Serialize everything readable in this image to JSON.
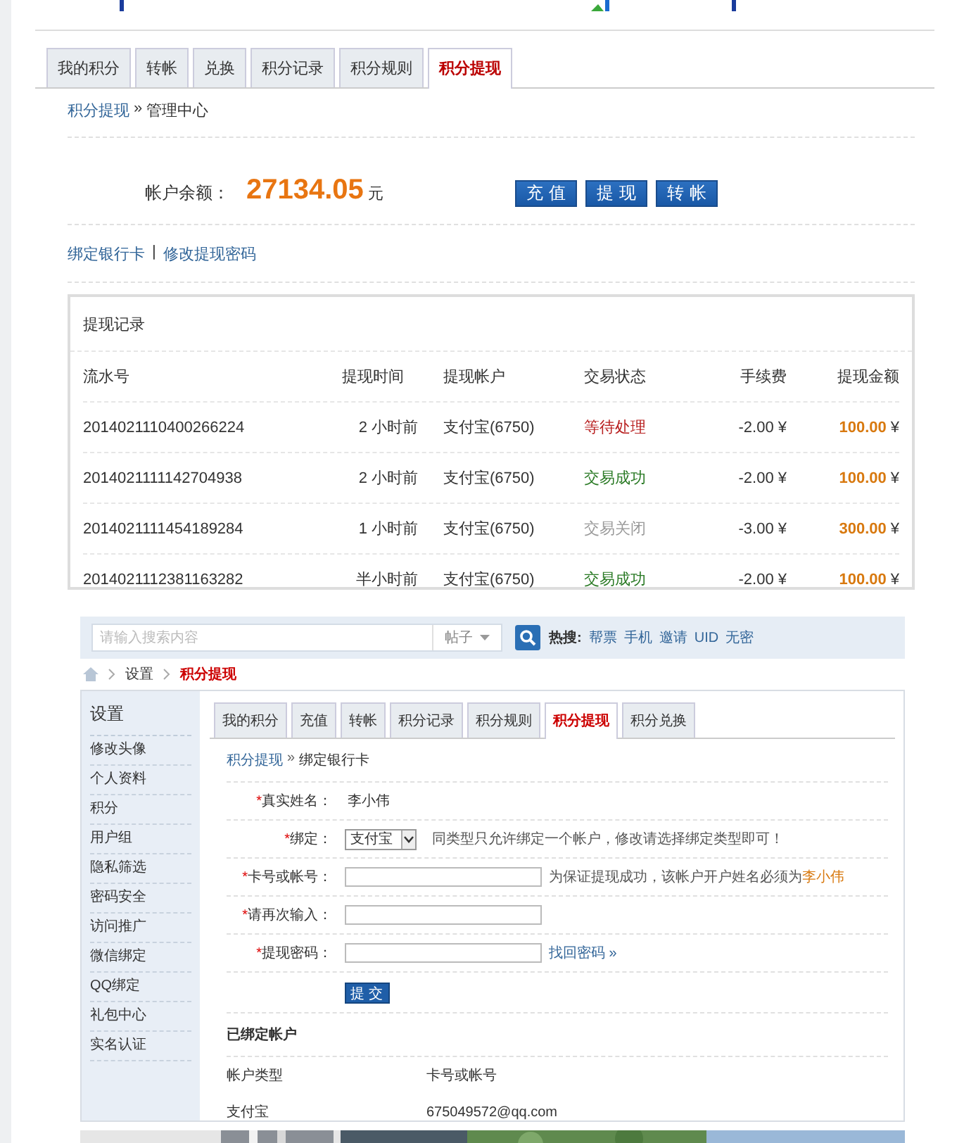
{
  "screen_1": {
    "tabs": [
      {
        "label": "我的积分",
        "selected": false
      },
      {
        "label": "转帐",
        "selected": false
      },
      {
        "label": "兑换",
        "selected": false
      },
      {
        "label": "积分记录",
        "selected": false
      },
      {
        "label": "积分规则",
        "selected": false
      },
      {
        "label": "积分提现",
        "selected": true
      }
    ],
    "breadcrumb": {
      "link": "积分提现",
      "separator": "»",
      "current": "管理中心"
    },
    "balance": {
      "label": "帐户余额：",
      "amount": "27134.05",
      "unit": "元"
    },
    "buttons": [
      "充值",
      "提现",
      "转帐"
    ],
    "links": [
      "绑定银行卡",
      "修改提现密码"
    ],
    "link_separator": "|",
    "records": {
      "title": "提现记录",
      "columns": [
        "流水号",
        "提现时间",
        "提现帐户",
        "交易状态",
        "手续费",
        "提现金额"
      ],
      "rows": [
        {
          "serial": "2014021110400266224",
          "time": "2 小时前",
          "account": "支付宝(6750)",
          "status": "等待处理",
          "kind": "pending",
          "fee": "-2.00 ¥",
          "amount": "100.00",
          "currency": "¥"
        },
        {
          "serial": "2014021111142704938",
          "time": "2 小时前",
          "account": "支付宝(6750)",
          "status": "交易成功",
          "kind": "success",
          "fee": "-2.00 ¥",
          "amount": "100.00",
          "currency": "¥"
        },
        {
          "serial": "2014021111454189284",
          "time": "1 小时前",
          "account": "支付宝(6750)",
          "status": "交易关闭",
          "kind": "closed",
          "fee": "-3.00 ¥",
          "amount": "300.00",
          "currency": "¥"
        },
        {
          "serial": "2014021112381163282",
          "time": "半小时前",
          "account": "支付宝(6750)",
          "status": "交易成功",
          "kind": "success",
          "fee": "-2.00 ¥",
          "amount": "100.00",
          "currency": "¥"
        }
      ]
    }
  },
  "screen_2": {
    "search": {
      "placeholder": "请输入搜索内容",
      "scope": "帖子",
      "hot_label": "热搜:",
      "hot_terms": [
        "帮票",
        "手机",
        "邀请",
        "UID",
        "无密"
      ]
    },
    "breadcrumb": [
      {
        "label": "设置",
        "selected": false
      },
      {
        "label": "积分提现",
        "selected": true
      }
    ],
    "sidebar": {
      "title": "设置",
      "items": [
        "修改头像",
        "个人资料",
        "积分",
        "用户组",
        "隐私筛选",
        "密码安全",
        "访问推广",
        "微信绑定",
        "QQ绑定",
        "礼包中心",
        "实名认证"
      ]
    },
    "tabs": [
      {
        "label": "我的积分",
        "selected": false
      },
      {
        "label": "充值",
        "selected": false
      },
      {
        "label": "转帐",
        "selected": false
      },
      {
        "label": "积分记录",
        "selected": false
      },
      {
        "label": "积分规则",
        "selected": false
      },
      {
        "label": "积分提现",
        "selected": true
      },
      {
        "label": "积分兑换",
        "selected": false
      }
    ],
    "sub_breadcrumb": {
      "link": "积分提现",
      "separator": "»",
      "current": "绑定银行卡"
    },
    "form": [
      {
        "kind": "text",
        "required_mark": "*",
        "label": "真实姓名：",
        "value": "李小伟"
      },
      {
        "kind": "select",
        "required_mark": "*",
        "label": "绑定：",
        "value": "支付宝",
        "hint": "同类型只允许绑定一个帐户，修改请选择绑定类型即可！"
      },
      {
        "kind": "input",
        "required_mark": "*",
        "label": "卡号或帐号：",
        "hint": "为保证提现成功，该帐户开户姓名必须为",
        "hint_name": "李小伟"
      },
      {
        "kind": "input",
        "required_mark": "*",
        "label": "请再次输入："
      },
      {
        "kind": "input",
        "required_mark": "*",
        "label": "提现密码：",
        "link": "找回密码 »"
      }
    ],
    "submit": "提交",
    "bound": {
      "title": "已绑定帐户",
      "columns": [
        "帐户类型",
        "卡号或帐号"
      ],
      "rows": [
        [
          "支付宝",
          "675049572@qq.com"
        ]
      ]
    }
  }
}
